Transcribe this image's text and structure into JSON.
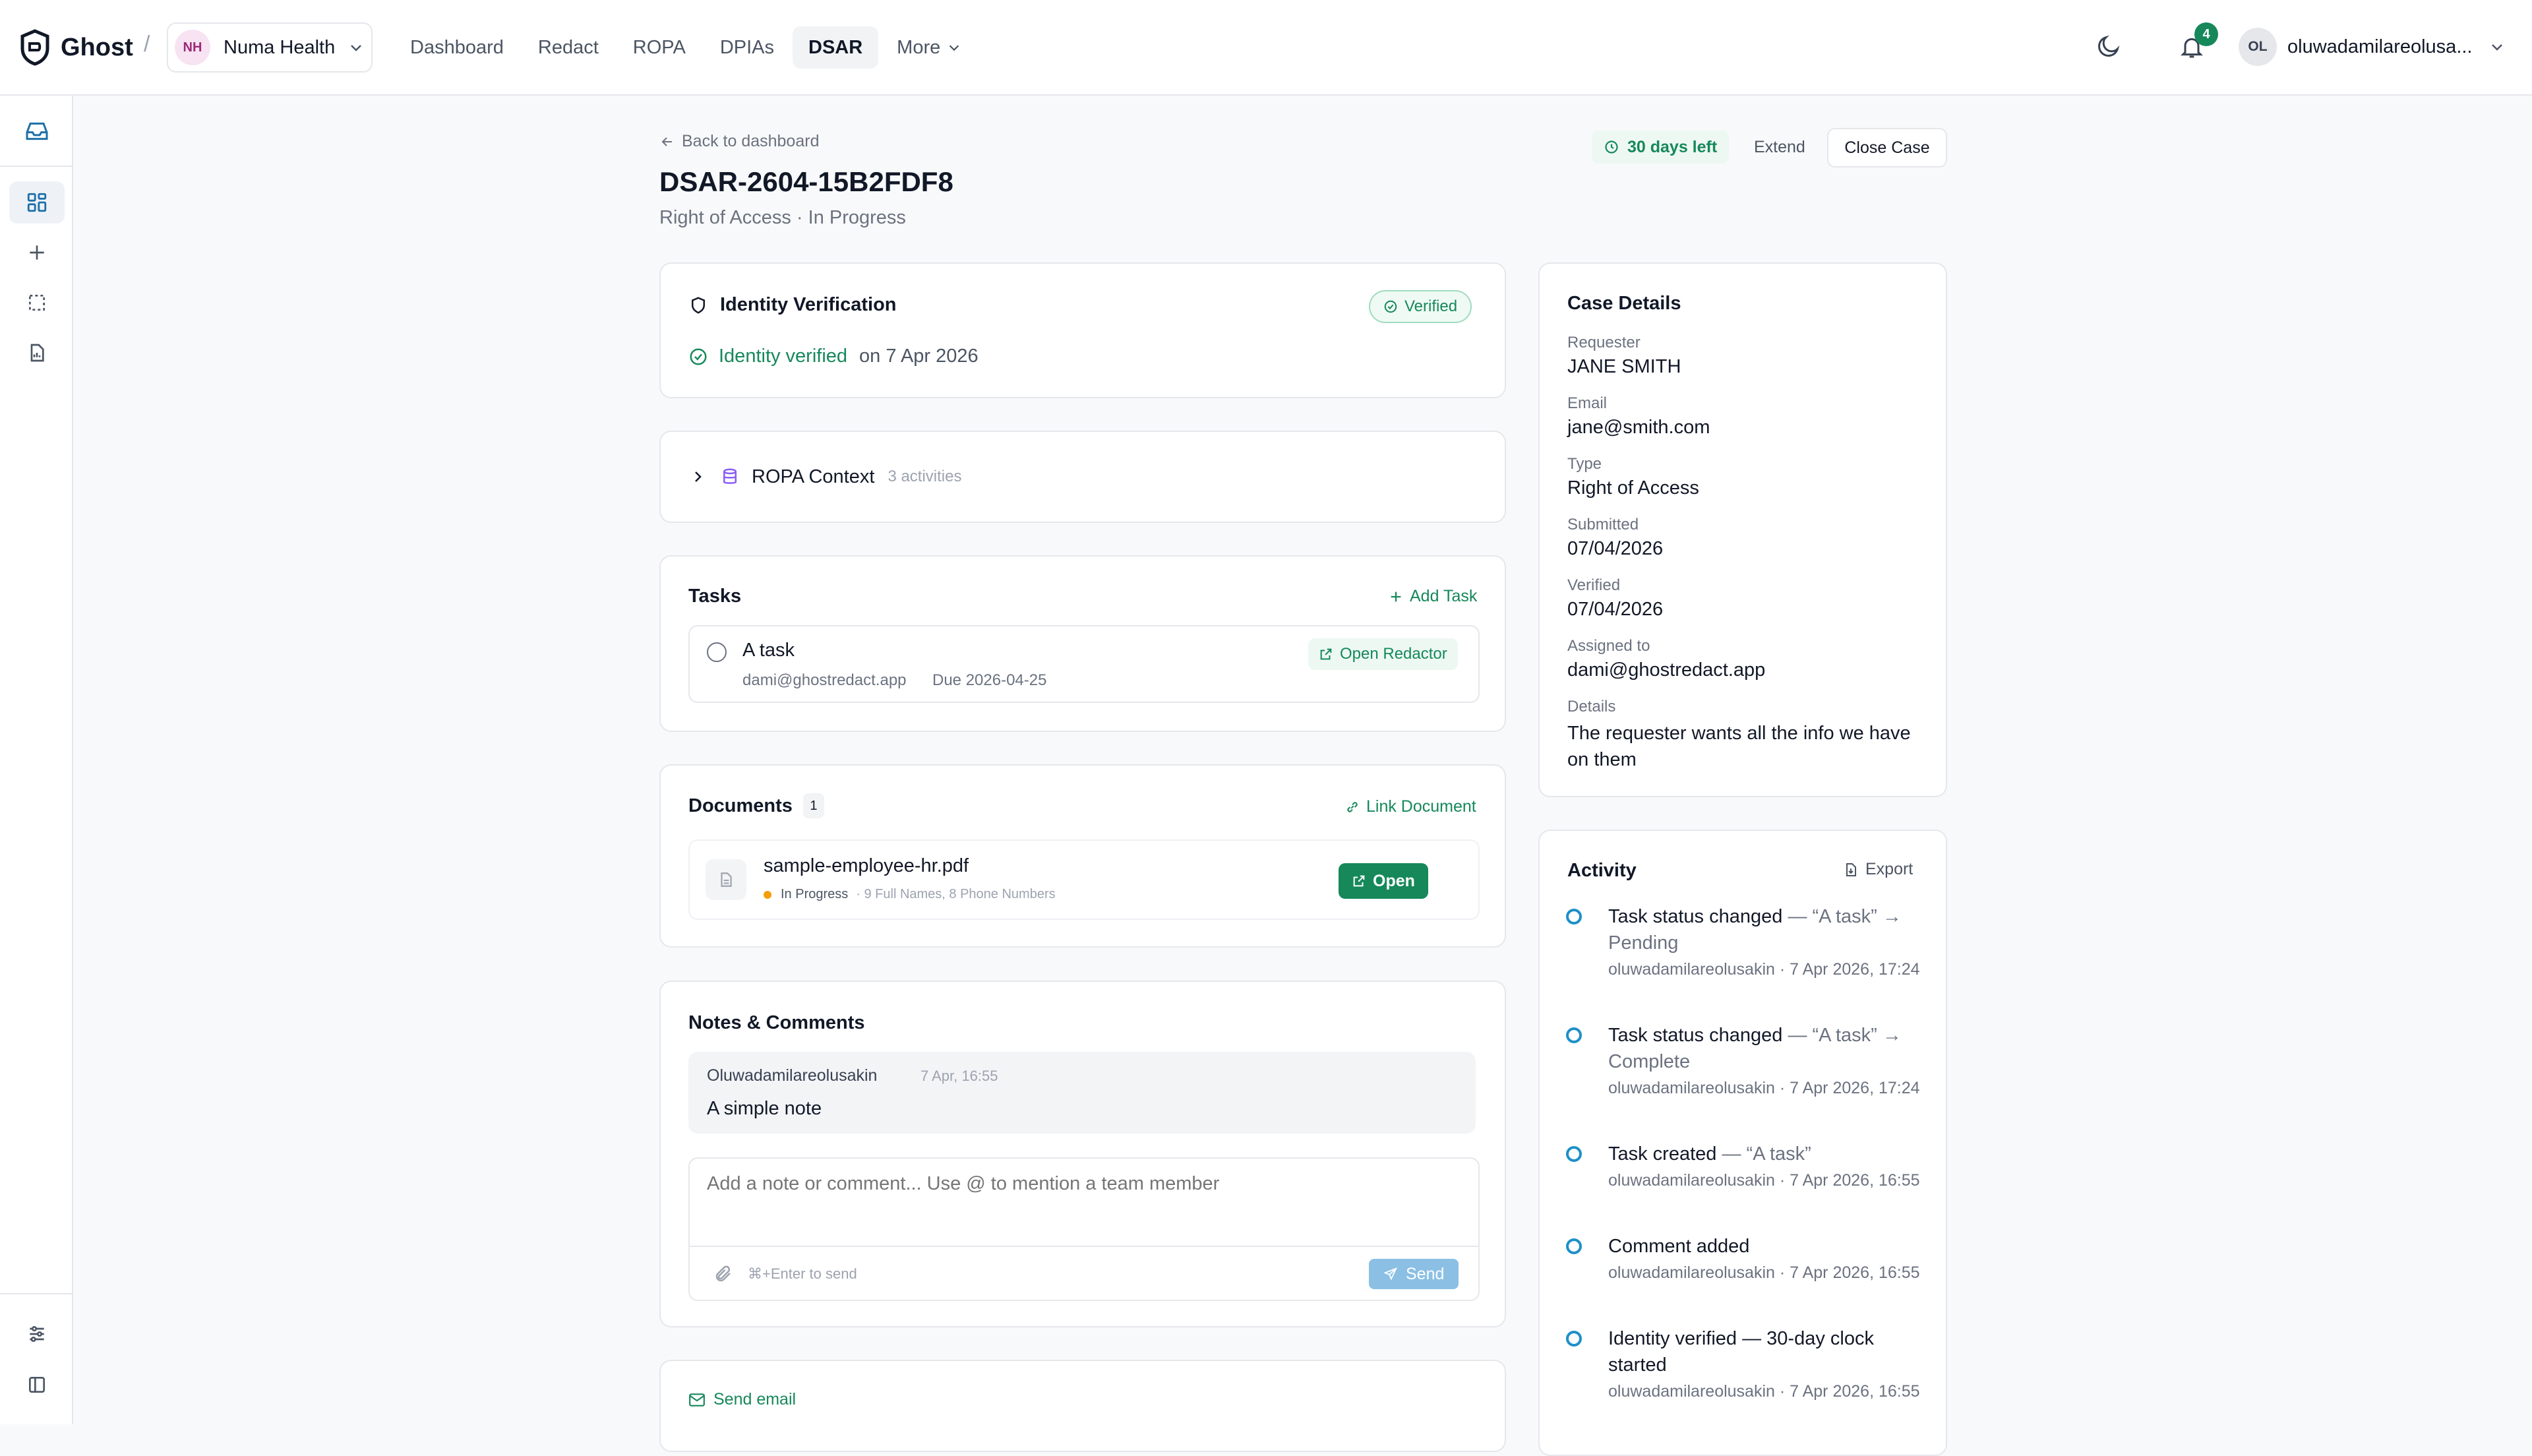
{
  "brand": {
    "name": "Ghost"
  },
  "workspace": {
    "initials": "NH",
    "name": "Numa Health"
  },
  "nav": [
    {
      "label": "Dashboard"
    },
    {
      "label": "Redact"
    },
    {
      "label": "ROPA"
    },
    {
      "label": "DPIAs"
    },
    {
      "label": "DSAR",
      "active": true
    },
    {
      "label": "More"
    }
  ],
  "notifications": {
    "count": "4"
  },
  "user": {
    "initials": "OL",
    "name": "oluwadamilareolusa..."
  },
  "header": {
    "back_label": "Back to dashboard",
    "case_id": "DSAR-2604-15B2FDF8",
    "subtitle": "Right of Access · In Progress",
    "days_left": "30 days left",
    "extend_label": "Extend",
    "close_label": "Close Case"
  },
  "identity": {
    "title": "Identity Verification",
    "badge": "Verified",
    "status": "Identity verified",
    "date": "on 7 Apr 2026"
  },
  "ropa": {
    "title": "ROPA Context",
    "count": "3 activities"
  },
  "tasks": {
    "title": "Tasks",
    "add_label": "Add Task",
    "items": [
      {
        "title": "A task",
        "assignee": "dami@ghostredact.app",
        "due": "Due 2026-04-25",
        "action": "Open Redactor"
      }
    ]
  },
  "documents": {
    "title": "Documents",
    "count": "1",
    "link_label": "Link Document",
    "items": [
      {
        "name": "sample-employee-hr.pdf",
        "status": "In Progress",
        "summary": "· 9 Full Names, 8 Phone Numbers",
        "action": "Open"
      }
    ]
  },
  "notes": {
    "title": "Notes & Comments",
    "items": [
      {
        "author": "Oluwadamilareolusakin",
        "time": "7 Apr, 16:55",
        "text": "A simple note"
      }
    ],
    "placeholder": "Add a note or comment... Use @ to mention a team member",
    "hint": "⌘+Enter to send",
    "send_label": "Send"
  },
  "email": {
    "label": "Send email"
  },
  "case_details": {
    "title": "Case Details",
    "fields": [
      {
        "label": "Requester",
        "value": "JANE SMITH"
      },
      {
        "label": "Email",
        "value": "jane@smith.com"
      },
      {
        "label": "Type",
        "value": "Right of Access"
      },
      {
        "label": "Submitted",
        "value": "07/04/2026"
      },
      {
        "label": "Verified",
        "value": "07/04/2026"
      },
      {
        "label": "Assigned to",
        "value": "dami@ghostredact.app"
      },
      {
        "label": "Details",
        "value": "The requester wants all the info we have on them"
      }
    ]
  },
  "activity": {
    "title": "Activity",
    "export_label": "Export",
    "items": [
      {
        "title": "Task status changed",
        "detail": " — “A task” → Pending",
        "meta": "oluwadamilareolusakin · 7 Apr 2026, 17:24"
      },
      {
        "title": "Task status changed",
        "detail": " — “A task” → Complete",
        "meta": "oluwadamilareolusakin · 7 Apr 2026, 17:24"
      },
      {
        "title": "Task created",
        "detail": " — “A task”",
        "meta": "oluwadamilareolusakin · 7 Apr 2026, 16:55"
      },
      {
        "title": "Comment added",
        "detail": "",
        "meta": "oluwadamilareolusakin · 7 Apr 2026, 16:55"
      },
      {
        "title": "Identity verified — 30-day clock started",
        "detail": "",
        "meta": "oluwadamilareolusakin · 7 Apr 2026, 16:55"
      }
    ]
  },
  "colors": {
    "accent": "#16885a",
    "timeline": "#1e90c8",
    "badge_red": "#16a34a",
    "status_dot": "#f59e0b"
  }
}
